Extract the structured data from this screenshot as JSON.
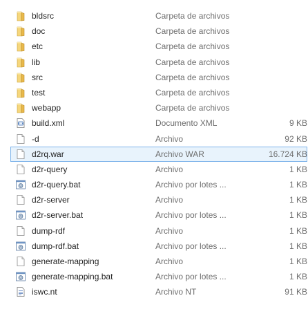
{
  "files": [
    {
      "name": "bldsrc",
      "type": "Carpeta de archivos",
      "size": "",
      "icon": "folder-icon"
    },
    {
      "name": "doc",
      "type": "Carpeta de archivos",
      "size": "",
      "icon": "folder-icon"
    },
    {
      "name": "etc",
      "type": "Carpeta de archivos",
      "size": "",
      "icon": "folder-icon"
    },
    {
      "name": "lib",
      "type": "Carpeta de archivos",
      "size": "",
      "icon": "folder-icon"
    },
    {
      "name": "src",
      "type": "Carpeta de archivos",
      "size": "",
      "icon": "folder-icon"
    },
    {
      "name": "test",
      "type": "Carpeta de archivos",
      "size": "",
      "icon": "folder-icon"
    },
    {
      "name": "webapp",
      "type": "Carpeta de archivos",
      "size": "",
      "icon": "folder-icon"
    },
    {
      "name": "build.xml",
      "type": "Documento XML",
      "size": "9 KB",
      "icon": "xml-document-icon"
    },
    {
      "name": "-d",
      "type": "Archivo",
      "size": "92 KB",
      "icon": "blank-file-icon"
    },
    {
      "name": "d2rq.war",
      "type": "Archivo WAR",
      "size": "16.724 KB",
      "icon": "blank-file-icon",
      "selected": true
    },
    {
      "name": "d2r-query",
      "type": "Archivo",
      "size": "1 KB",
      "icon": "blank-file-icon"
    },
    {
      "name": "d2r-query.bat",
      "type": "Archivo por lotes ...",
      "size": "1 KB",
      "icon": "batch-file-icon"
    },
    {
      "name": "d2r-server",
      "type": "Archivo",
      "size": "1 KB",
      "icon": "blank-file-icon"
    },
    {
      "name": "d2r-server.bat",
      "type": "Archivo por lotes ...",
      "size": "1 KB",
      "icon": "batch-file-icon"
    },
    {
      "name": "dump-rdf",
      "type": "Archivo",
      "size": "1 KB",
      "icon": "blank-file-icon"
    },
    {
      "name": "dump-rdf.bat",
      "type": "Archivo por lotes ...",
      "size": "1 KB",
      "icon": "batch-file-icon"
    },
    {
      "name": "generate-mapping",
      "type": "Archivo",
      "size": "1 KB",
      "icon": "blank-file-icon"
    },
    {
      "name": "generate-mapping.bat",
      "type": "Archivo por lotes ...",
      "size": "1 KB",
      "icon": "batch-file-icon"
    },
    {
      "name": "iswc.nt",
      "type": "Archivo NT",
      "size": "91 KB",
      "icon": "text-file-icon"
    }
  ]
}
